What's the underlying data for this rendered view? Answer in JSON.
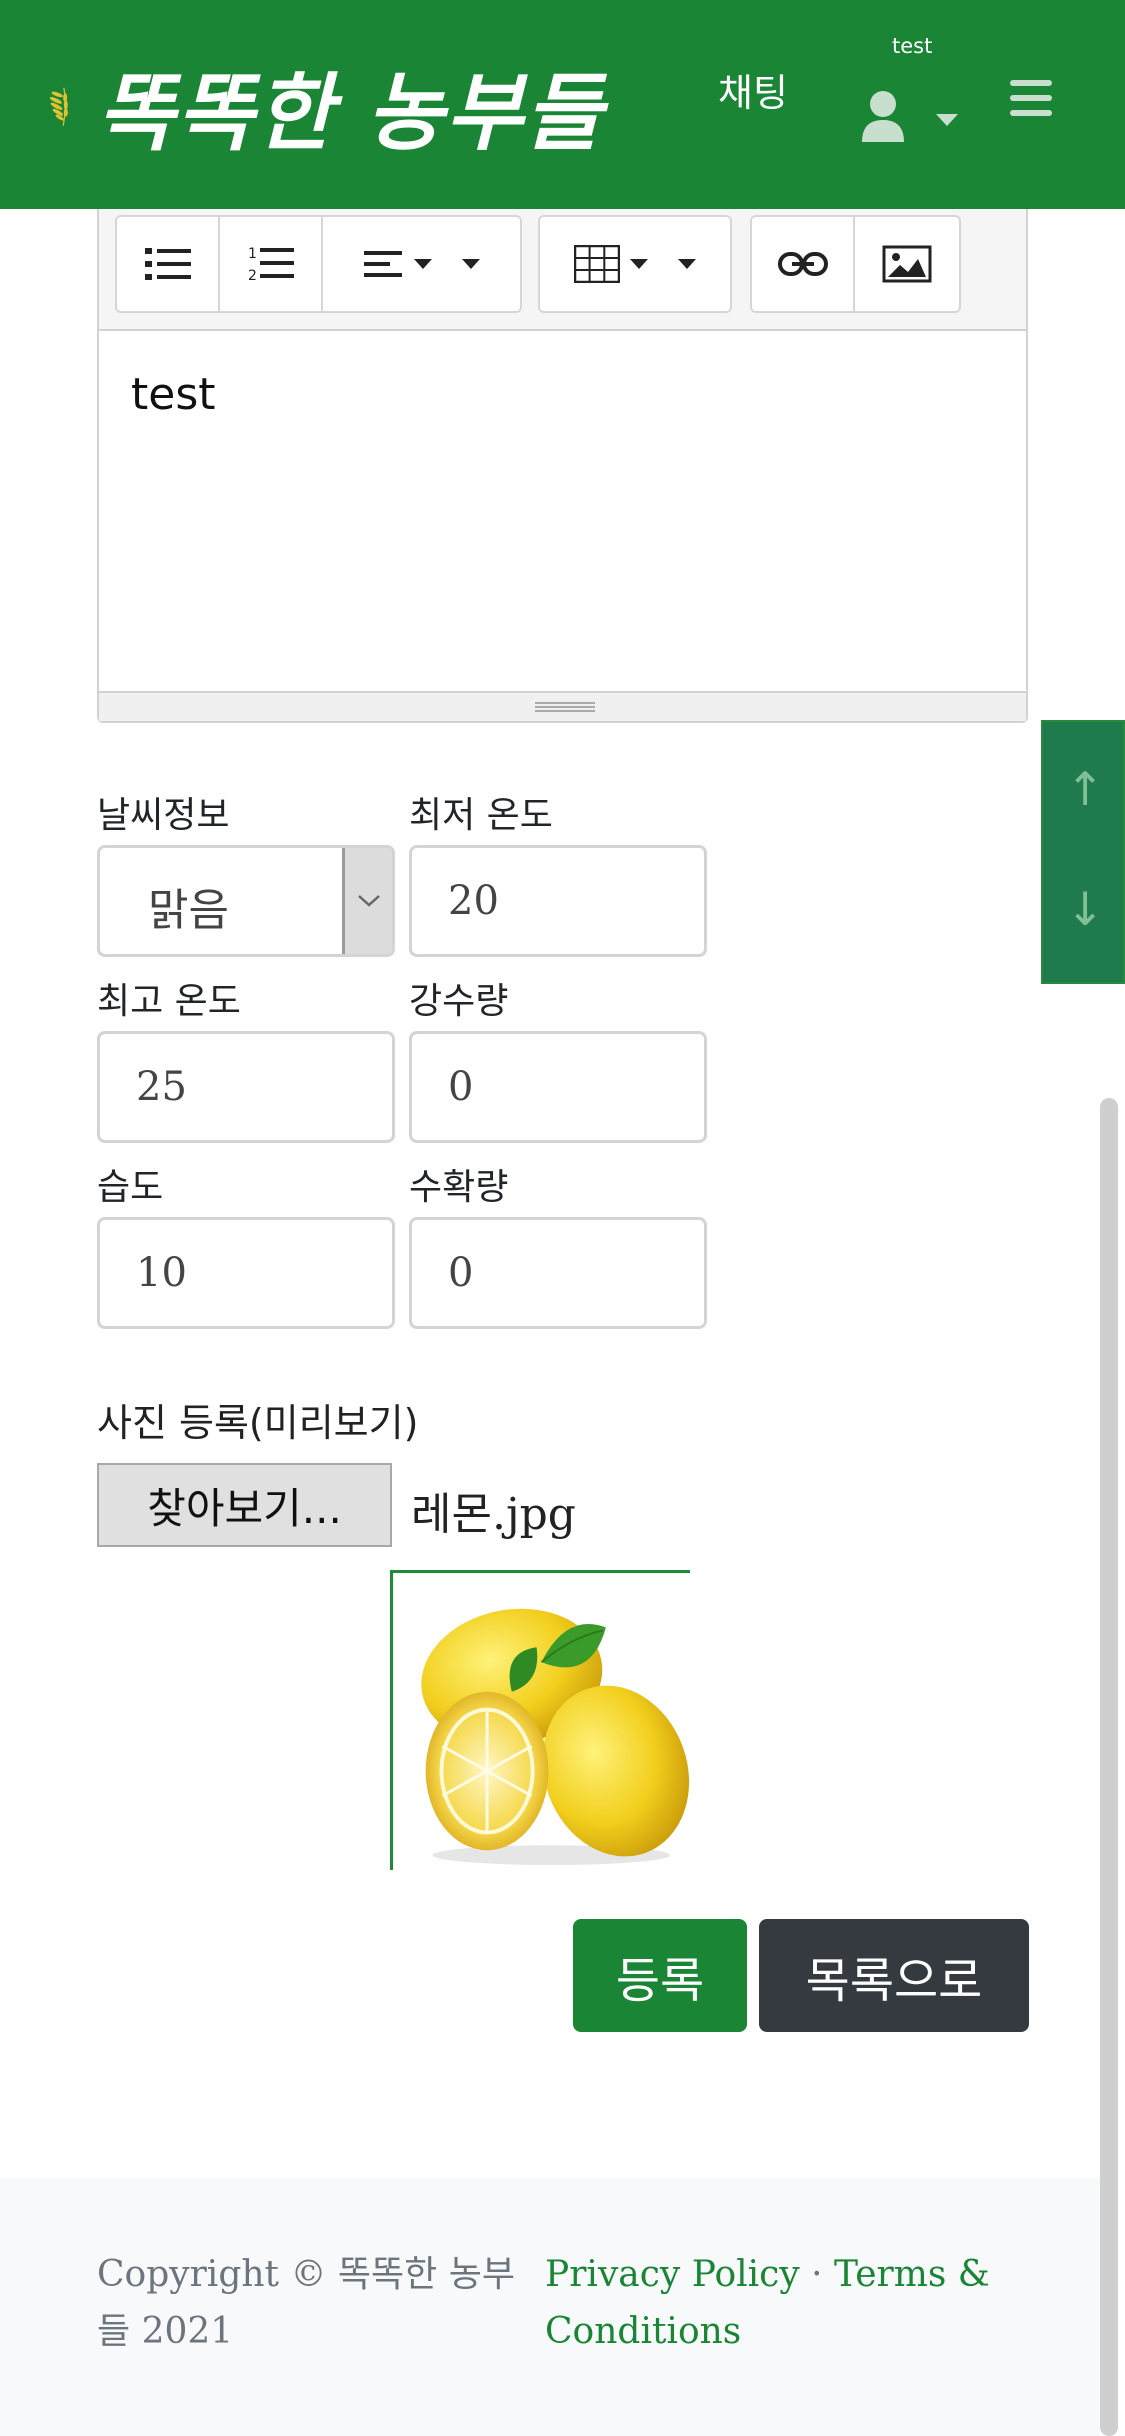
{
  "header": {
    "logo_text": "똑똑한 농부들",
    "chat_label": "채팅",
    "user_name": "test",
    "brand_color": "#198535"
  },
  "editor": {
    "toolbar": {
      "buttons": [
        "unordered-list-icon",
        "ordered-list-icon",
        "align-icon",
        "table-icon",
        "link-icon",
        "image-icon"
      ]
    },
    "content": "test"
  },
  "form": {
    "weather_label": "날씨정보",
    "weather_value": "맑음",
    "min_temp_label": "최저 온도",
    "min_temp_value": "20",
    "max_temp_label": "최고 온도",
    "max_temp_value": "25",
    "rain_label": "강수량",
    "rain_value": "0",
    "humidity_label": "습도",
    "humidity_value": "10",
    "harvest_label": "수확량",
    "harvest_value": "0",
    "photo_label": "사진 등록(미리보기)",
    "browse_label": "찾아보기...",
    "file_name": "레몬.jpg"
  },
  "actions": {
    "submit_label": "등록",
    "list_label": "목록으로"
  },
  "scroll_helper": {
    "up": "↑",
    "down": "↓"
  },
  "footer": {
    "copyright": "Copyright © 똑똑한 농부들 2021",
    "privacy": "Privacy Policy",
    "separator": "·",
    "terms": "Terms & Conditions"
  }
}
